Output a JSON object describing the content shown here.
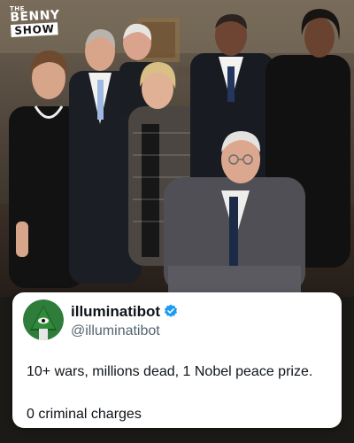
{
  "watermark": {
    "the": "THE",
    "benny": "BENNY",
    "show": "SHOW"
  },
  "photo": {
    "icon": "group-photo-image"
  },
  "tweet": {
    "display_name": "illuminatibot",
    "handle": "@illuminatibot",
    "verified_icon": "verified-badge-icon",
    "avatar_icon": "eye-pyramid-avatar",
    "line1": "10+ wars, millions dead, 1 Nobel peace prize.",
    "line2": "0 criminal charges"
  },
  "colors": {
    "card_background": "#ffffff",
    "text_primary": "#0f1419",
    "text_secondary": "#536471",
    "verified_blue": "#1d9bf0",
    "avatar_green": "#2f7d3a"
  }
}
